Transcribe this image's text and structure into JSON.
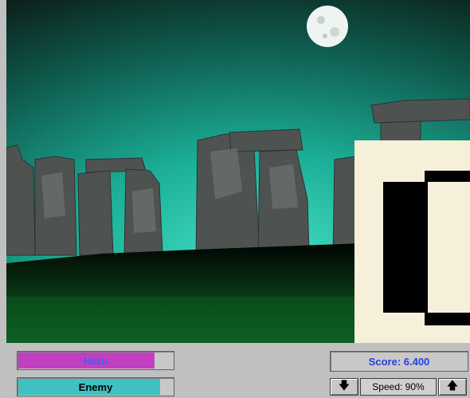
{
  "scene": {
    "sky_top": "#101a14",
    "sky_mid": "#1aa890",
    "sky_bottom": "#40e0c8",
    "ground": "#000000",
    "grass": "#0c5a20",
    "moon": "#e8f0ee",
    "stone": "#5a5a5a",
    "panel_cream": "#f6f0da"
  },
  "hud": {
    "hero_label": "Hero",
    "hero_fraction": 0.87,
    "enemy_label": "Enemy",
    "enemy_fraction": 0.91,
    "score_text": "Score:  6.400",
    "speed_text": "Speed: 90%",
    "speed_down_icon": "arrow-down-icon",
    "speed_up_icon": "arrow-up-icon",
    "speed_down_symbol": "🡇",
    "speed_up_symbol": "🡅"
  }
}
